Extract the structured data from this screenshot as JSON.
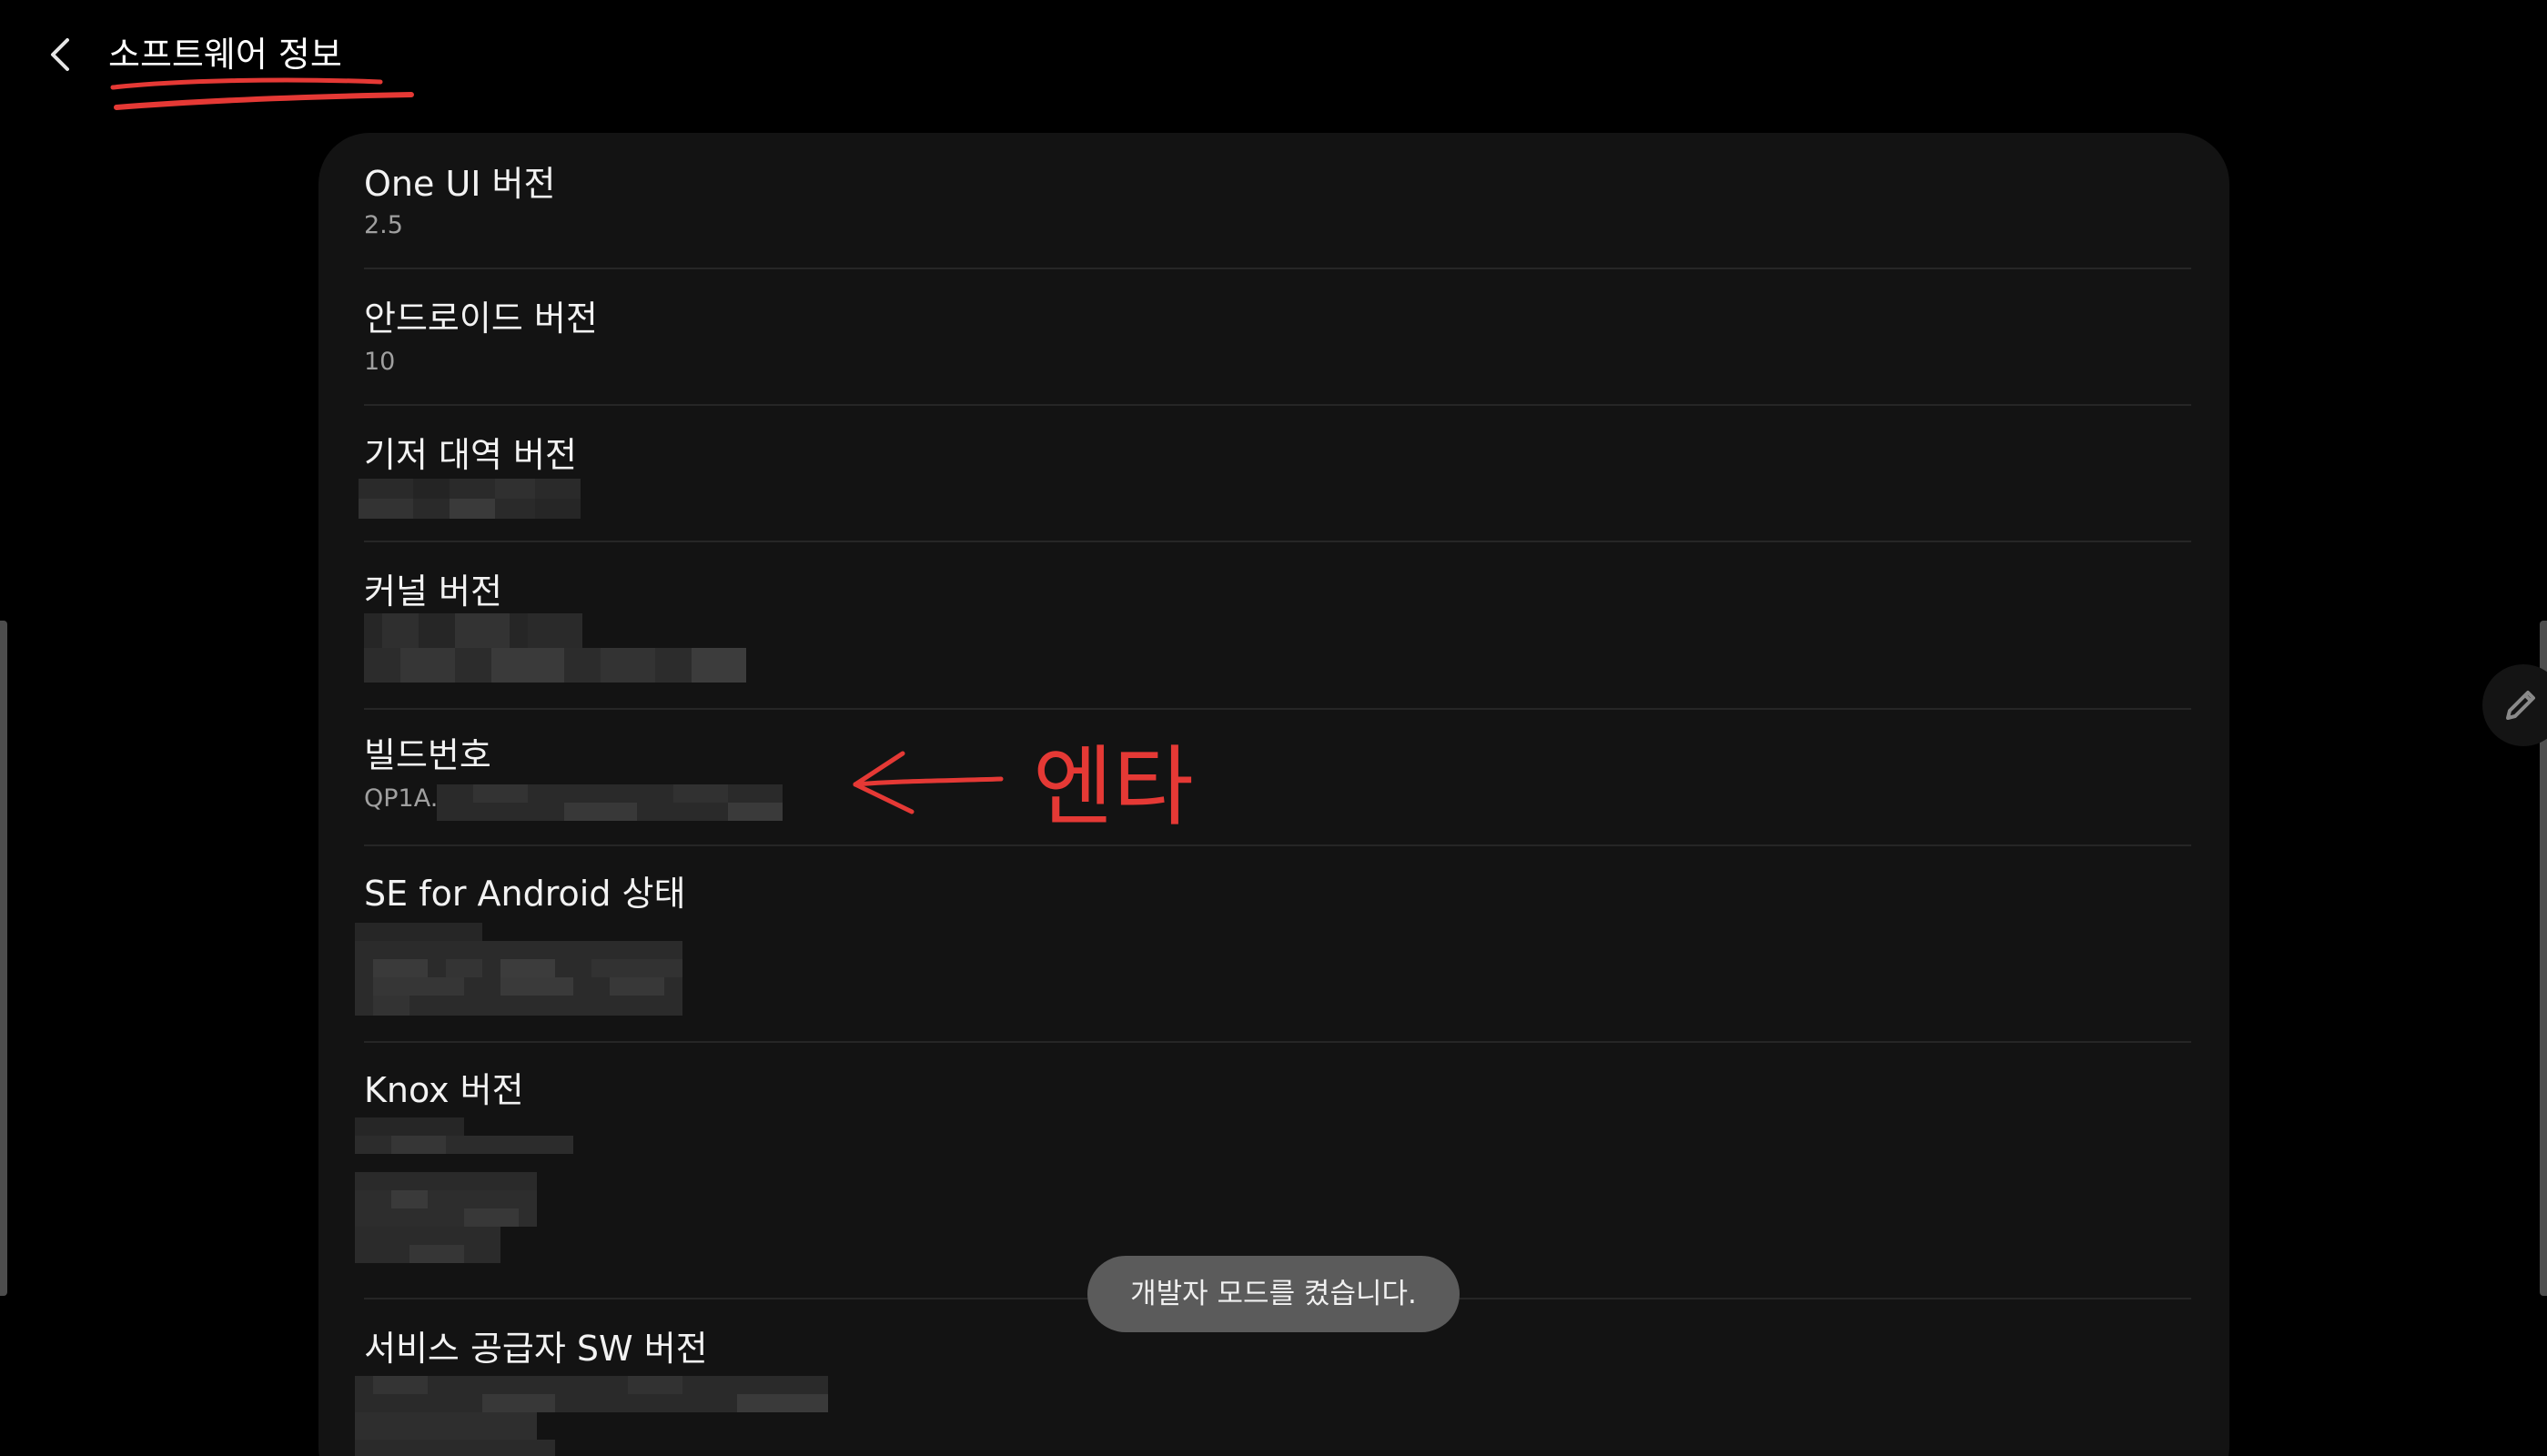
{
  "header": {
    "title": "소프트웨어 정보",
    "back_icon": "chevron-left-icon"
  },
  "rows": [
    {
      "title": "One UI 버전",
      "value": "2.5"
    },
    {
      "title": "안드로이드 버전",
      "value": "10"
    },
    {
      "title": "기저 대역 버전",
      "value": ""
    },
    {
      "title": "커널 버전",
      "value": ""
    },
    {
      "title": "빌드번호",
      "value": "QP1A."
    },
    {
      "title": "SE for Android 상태",
      "value": ""
    },
    {
      "title": "Knox 버전",
      "value": ""
    },
    {
      "title": "서비스 공급자 SW 버전",
      "value": ""
    }
  ],
  "toast": {
    "message": "개발자 모드를 켰습니다."
  },
  "side_button": {
    "icon": "pencil-icon"
  },
  "annotation": {
    "text": "엔타",
    "color": "#e53935"
  },
  "colors": {
    "background": "#000000",
    "panel": "#131313",
    "accent_annotation": "#e53935",
    "toast": "#5b5b5b"
  }
}
